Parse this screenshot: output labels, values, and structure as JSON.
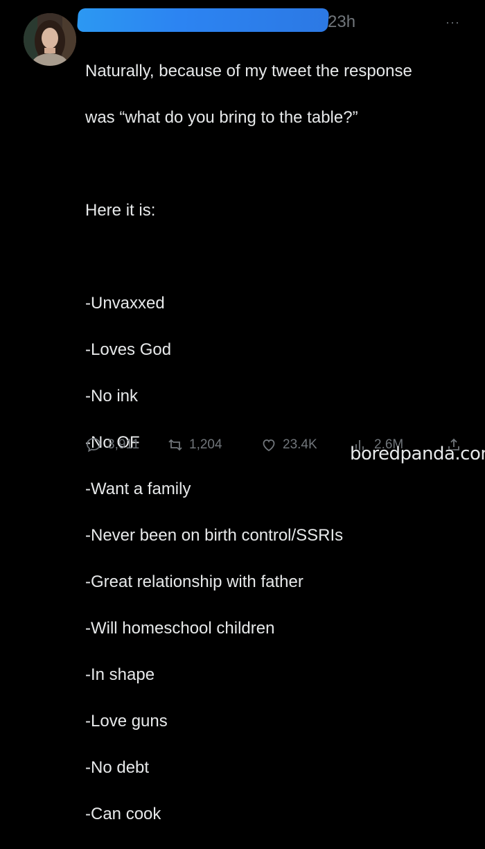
{
  "post": {
    "time": "23h",
    "more_label": "···",
    "intro_line1": "Naturally, because of my tweet the response",
    "intro_line2": "was “what do you bring to the table?”",
    "lead": "Here it is:",
    "list": [
      "-Unvaxxed",
      "-Loves God",
      "-No ink",
      "-No OF",
      "-Want a family",
      "-Never been on birth control/SSRIs",
      "-Great relationship with father",
      "-Will homeschool children",
      "-In shape",
      "-Love guns",
      "-No debt",
      "-Can cook"
    ]
  },
  "actions": {
    "replies": "3,911",
    "reposts": "1,204",
    "likes": "23.4K",
    "views": "2.6M"
  },
  "watermark": "boredpanda.com",
  "icons": [
    "reply-icon",
    "repost-icon",
    "like-icon",
    "views-icon",
    "share-icon",
    "more-icon"
  ]
}
